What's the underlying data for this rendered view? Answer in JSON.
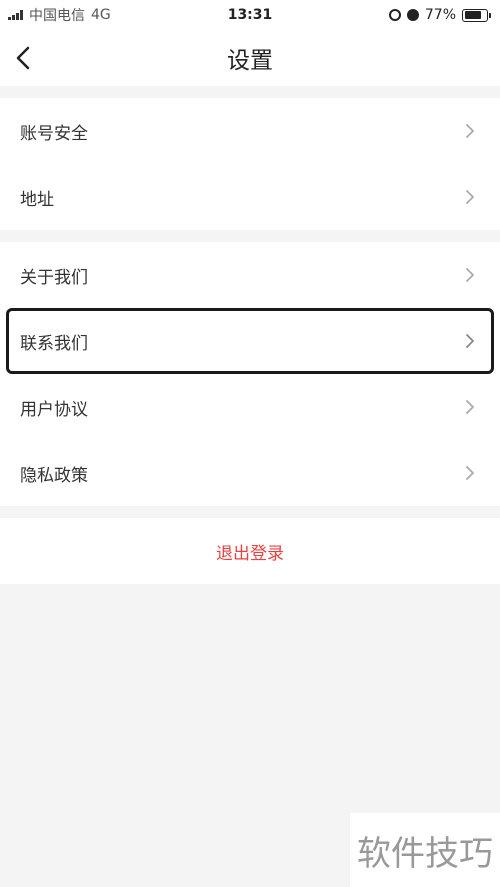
{
  "status_bar": {
    "carrier": "中国电信",
    "network": "4G",
    "time": "13:31",
    "battery": "77%",
    "battery_level": 0.77,
    "icons": [
      "signal-icon",
      "rotation-lock-icon",
      "alarm-icon",
      "battery-icon"
    ]
  },
  "header": {
    "title": "设置",
    "back_icon": "chevron-left-icon"
  },
  "group_account": {
    "items": [
      {
        "label": "账号安全"
      },
      {
        "label": "地址"
      }
    ]
  },
  "group_about": {
    "items": [
      {
        "label": "关于我们"
      },
      {
        "label": "联系我们"
      },
      {
        "label": "用户协议"
      },
      {
        "label": "隐私政策"
      }
    ]
  },
  "logout": {
    "label": "退出登录",
    "color": "#e64340"
  },
  "watermark": {
    "text": "软件技巧"
  }
}
